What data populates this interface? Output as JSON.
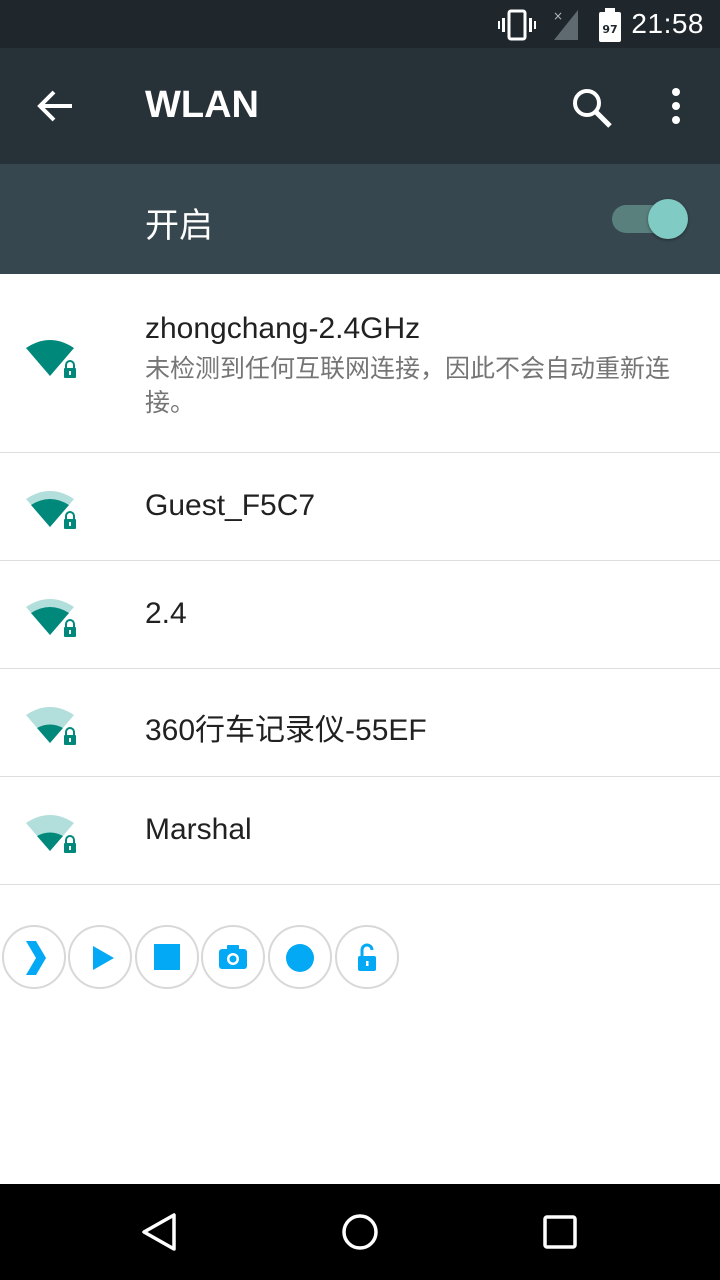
{
  "status_bar": {
    "time": "21:58",
    "battery_level": "97",
    "icons": [
      "vibrate-icon",
      "no-signal-icon",
      "battery-icon"
    ]
  },
  "app_bar": {
    "title": "WLAN",
    "icons": [
      "back-arrow-icon",
      "search-icon",
      "more-vert-icon"
    ]
  },
  "master_switch": {
    "label": "开启",
    "on": true
  },
  "networks": [
    {
      "ssid": "zhongchang-2.4GHz",
      "summary": "未检测到任何互联网连接，因此不会自动重新连接。",
      "secured": true,
      "signal": 4
    },
    {
      "ssid": "Guest_F5C7",
      "summary": "",
      "secured": true,
      "signal": 3
    },
    {
      "ssid": "2.4",
      "summary": "",
      "secured": true,
      "signal": 3
    },
    {
      "ssid": "360行车记录仪-55EF",
      "summary": "",
      "secured": true,
      "signal": 2
    },
    {
      "ssid": "Marshal",
      "summary": "",
      "secured": true,
      "signal": 2
    }
  ],
  "floating_toolbar": {
    "buttons": [
      "expand-chevron-icon",
      "play-icon",
      "stop-icon",
      "camera-icon",
      "record-dot-icon",
      "unlock-icon"
    ]
  },
  "nav_bar": {
    "buttons": [
      "back-triangle-icon",
      "home-circle-icon",
      "recents-square-icon"
    ]
  },
  "colors": {
    "status_bar": "#1f272c",
    "app_bar": "#263238",
    "switch_bar": "#37474f",
    "accent": "#00897b",
    "accent_light": "#80cbc4",
    "toolbar_blue": "#03a9f4"
  }
}
